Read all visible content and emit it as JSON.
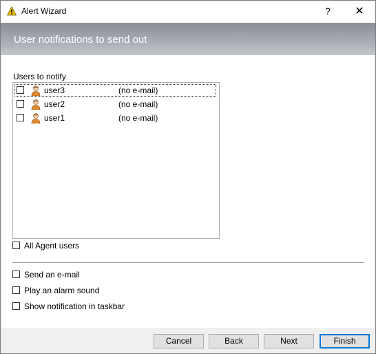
{
  "window": {
    "title": "Alert Wizard",
    "help_glyph": "?",
    "close_glyph": "✕"
  },
  "banner": {
    "heading": "User notifications to send out"
  },
  "users_group": {
    "label": "Users to notify",
    "users": [
      {
        "name": "user3",
        "email": "(no e-mail)",
        "checked": false,
        "focused": true
      },
      {
        "name": "user2",
        "email": "(no e-mail)",
        "checked": false,
        "focused": false
      },
      {
        "name": "user1",
        "email": "(no e-mail)",
        "checked": false,
        "focused": false
      }
    ]
  },
  "options": {
    "all_agent_users": "All Agent users",
    "send_email": "Send an e-mail",
    "play_alarm": "Play an alarm sound",
    "show_taskbar": "Show notification in taskbar"
  },
  "buttons": {
    "cancel": "Cancel",
    "back": "Back",
    "next": "Next",
    "finish": "Finish"
  },
  "colors": {
    "accent": "#0078d7",
    "warning_icon": "#f2c200"
  }
}
